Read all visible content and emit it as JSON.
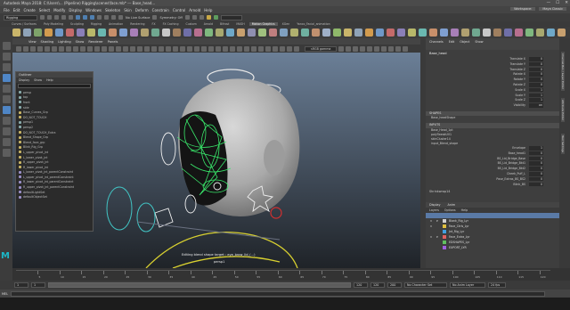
{
  "window": {
    "title": "Autodesk Maya 2018: C:\\Users\\... (Pipeline) Rigging\\scenes\\face.mb* --- Base_head...",
    "controls": [
      "—",
      "☐",
      "✕"
    ]
  },
  "menubar": {
    "items": [
      "File",
      "Edit",
      "Create",
      "Select",
      "Modify",
      "Display",
      "Windows",
      "Skeleton",
      "Skin",
      "Deform",
      "Constrain",
      "Control",
      "Arnold",
      "Help"
    ],
    "workspace_label": "Workspace:",
    "workspace_value": "Maya Classic"
  },
  "status_line": {
    "mode": "Rigging",
    "live_surface": "No Live Surface",
    "symmetry": "Symmetry: Off"
  },
  "shelf": {
    "tabs": [
      "Curves / Surfaces",
      "Poly Modeling",
      "Sculpting",
      "Rigging",
      "Animation",
      "Rendering",
      "FX",
      "FX Caching",
      "Custom",
      "Arnold",
      "Bifrost",
      "MASH",
      "Motion Graphics",
      "XGen",
      "Yanco_Facial_animation"
    ],
    "active_tab": "Motion Graphics",
    "icon_colors": [
      "#c9b56a",
      "#8fa3b8",
      "#7ea36a",
      "#d29b4e",
      "#6f98c8",
      "#c46a6a",
      "#8a7fb8",
      "#b8b86a",
      "#6ab8b0",
      "#c88f6a",
      "#7f9fd0",
      "#a87fb8",
      "#b0a070",
      "#70a890",
      "#c8c8c8",
      "#9f7f5f",
      "#6f6fa8",
      "#b86f8f",
      "#7fb87f",
      "#a8a86f",
      "#6fa8c8",
      "#c8a06f",
      "#8f8fb0",
      "#a0c07f",
      "#c07f7f",
      "#7fa0c0",
      "#b0b06f",
      "#6fb0a0",
      "#c0906f",
      "#9fb0c8",
      "#8fb86a",
      "#c9b56a",
      "#8fa3b8",
      "#d29b4e",
      "#6f98c8",
      "#c46a6a",
      "#8a7fb8",
      "#b8b86a",
      "#6ab8b0",
      "#c88f6a",
      "#7f9fd0",
      "#a87fb8",
      "#b0a070",
      "#70a890",
      "#c8c8c8",
      "#9f7f5f",
      "#6f6fa8",
      "#b86f8f",
      "#7fb87f",
      "#a8a86f",
      "#6fa8c8",
      "#c8a06f"
    ]
  },
  "viewport": {
    "menu": [
      "View",
      "Shading",
      "Lighting",
      "Show",
      "Renderer",
      "Panels"
    ],
    "color_space": "sRGB gamma",
    "hud_message": "Editing blend shape target : eye_brow_lid_(...)",
    "camera": "persp1"
  },
  "outliner": {
    "title": "Outliner",
    "menu": [
      "Display",
      "Show",
      "Help"
    ],
    "items": [
      {
        "label": "persp",
        "type": "cam"
      },
      {
        "label": "top",
        "type": "cam"
      },
      {
        "label": "front",
        "type": "cam"
      },
      {
        "label": "side",
        "type": "cam"
      },
      {
        "label": "Base_Curves_Grp",
        "type": "grp"
      },
      {
        "label": "DO_NOT_TOUCH",
        "type": "grp"
      },
      {
        "label": "persp1",
        "type": "cam"
      },
      {
        "label": "persp2",
        "type": "cam"
      },
      {
        "label": "DO_NOT_TOUCH_Extra",
        "type": "grp"
      },
      {
        "label": "Blend_Shape_Grp",
        "type": "grp"
      },
      {
        "label": "Blend_face_grp",
        "type": "grp"
      },
      {
        "label": "Blink_Rig_Grp",
        "type": "grp"
      },
      {
        "label": "L_upper_pivot_jnt",
        "type": "grp"
      },
      {
        "label": "L_lower_pivot_jnt",
        "type": "grp"
      },
      {
        "label": "R_upper_pivot_jnt",
        "type": "grp"
      },
      {
        "label": "R_lower_pivot_jnt",
        "type": "grp"
      },
      {
        "label": "L_lower_pivot_jnt_parentConstraint",
        "type": "set"
      },
      {
        "label": "L_upper_pivot_jnt_parentConstraint",
        "type": "set"
      },
      {
        "label": "R_lower_pivot_jnt_parentConstraint",
        "type": "set"
      },
      {
        "label": "R_upper_pivot_jnt_parentConstraint",
        "type": "set"
      },
      {
        "label": "defaultLightSet",
        "type": "set"
      },
      {
        "label": "defaultObjectSet",
        "type": "set"
      }
    ]
  },
  "channel_box": {
    "tabs": [
      "Channels",
      "Edit",
      "Object",
      "Show"
    ],
    "node": "Base_head",
    "attributes": [
      {
        "label": "Translate X",
        "value": "0"
      },
      {
        "label": "Translate Y",
        "value": "0"
      },
      {
        "label": "Translate Z",
        "value": "0"
      },
      {
        "label": "Rotate X",
        "value": "0"
      },
      {
        "label": "Rotate Y",
        "value": "0"
      },
      {
        "label": "Rotate Z",
        "value": "0"
      },
      {
        "label": "Scale X",
        "value": "1"
      },
      {
        "label": "Scale Y",
        "value": "1"
      },
      {
        "label": "Scale Z",
        "value": "1"
      },
      {
        "label": "Visibility",
        "value": "on"
      }
    ],
    "shapes_header": "SHAPES",
    "shape": "Base_headShape",
    "inputs_header": "INPUTS",
    "inputs": [
      "Base_Head_1pt",
      "polyTweakUV1",
      "skinCluster14",
      "input_Blend_shape"
    ],
    "blend_attributes": [
      {
        "label": "Envelope",
        "value": "1"
      },
      {
        "label": "Base_head1",
        "value": "0"
      },
      {
        "label": "BS_Lid_Bridge_Base",
        "value": "0"
      },
      {
        "label": "BS_Lid_Bridge_Bkt1",
        "value": "0"
      },
      {
        "label": "BS_Lid_Bridge_Bkt2",
        "value": "0"
      },
      {
        "label": "Cheek_Puff_L",
        "value": "0"
      },
      {
        "label": "Pose_Extras_BS_BS2",
        "value": "0"
      },
      {
        "label": "Blink_BS",
        "value": "0"
      }
    ],
    "lower_section": "Shrinkwrap14"
  },
  "side_tabs": [
    "Channel Box / Layer Editor",
    "Attribute Editor",
    "Tool Settings"
  ],
  "layers": {
    "tabs": [
      "Display",
      "Anim"
    ],
    "menu": [
      "Layers",
      "Options",
      "Help"
    ],
    "items": [
      {
        "label": "Blank_Rig_Lyr",
        "v": "V",
        "p": "P",
        "color": "#d0d0d0"
      },
      {
        "label": "Face_Ctrls_Lyr",
        "v": "V",
        "p": "",
        "color": "#e0c040"
      },
      {
        "label": "Jnt_Rig_Lyr",
        "v": "",
        "p": "",
        "color": "#40a0e0"
      },
      {
        "label": "Face_Extra_Lyr",
        "v": "V",
        "p": "P",
        "color": "#e06060"
      },
      {
        "label": "EDSHAPES_Lyr",
        "v": "",
        "p": "",
        "color": "#60c060"
      },
      {
        "label": "EXPORT_LYR",
        "v": "",
        "p": "",
        "color": "#a060e0"
      }
    ]
  },
  "time_slider": {
    "labels": [
      "5",
      "10",
      "15",
      "20",
      "25",
      "30",
      "35",
      "40",
      "45",
      "50",
      "55",
      "60",
      "65",
      "70",
      "75",
      "80",
      "85",
      "90",
      "95",
      "100",
      "105",
      "110",
      "115",
      "120"
    ]
  },
  "range_slider": {
    "start": "1",
    "range_start": "1",
    "range_end": "120",
    "end": "120",
    "max": "200",
    "character_set": "No Character Set",
    "anim_layer": "No Anim Layer",
    "fps": "24 fps"
  },
  "command_line": {
    "label": "MEL"
  }
}
